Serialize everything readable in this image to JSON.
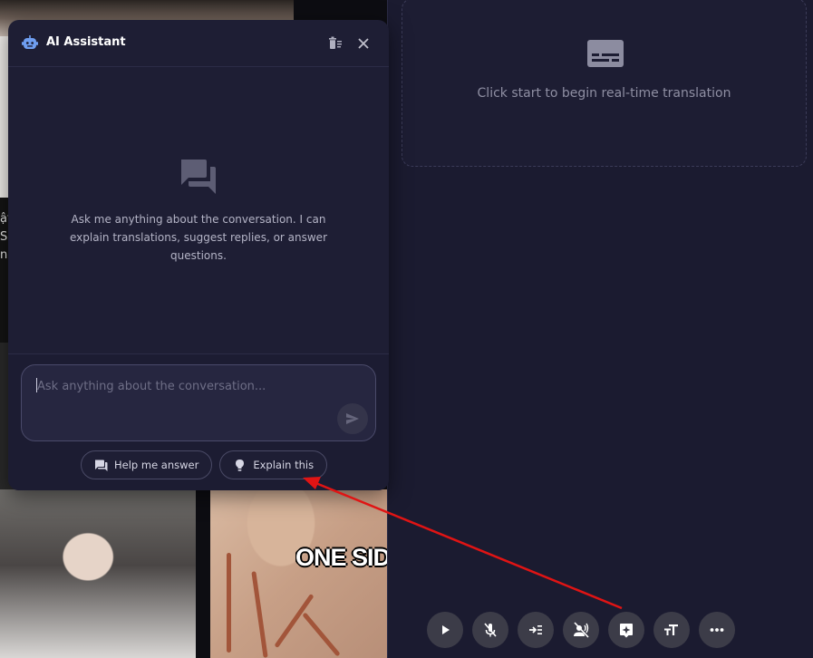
{
  "assistant": {
    "title": "AI Assistant",
    "empty_message": "Ask me anything about the conversation. I can explain translations, suggest replies, or answer questions.",
    "input_placeholder": "Ask anything about the conversation...",
    "input_value": "",
    "chips": [
      {
        "label": "Help me answer",
        "icon": "question-answer-icon"
      },
      {
        "label": "Explain this",
        "icon": "lightbulb-icon"
      }
    ]
  },
  "translation": {
    "hint": "Click start to begin real-time translation"
  },
  "toolbar": {
    "buttons": [
      {
        "name": "play-button",
        "icon": "play-icon"
      },
      {
        "name": "mute-mic-button",
        "icon": "mic-off-icon"
      },
      {
        "name": "input-button",
        "icon": "input-icon"
      },
      {
        "name": "voice-off-button",
        "icon": "voice-off-icon"
      },
      {
        "name": "ai-assistant-button",
        "icon": "assistant-icon"
      },
      {
        "name": "text-size-button",
        "icon": "text-size-icon"
      },
      {
        "name": "more-button",
        "icon": "more-horiz-icon"
      }
    ]
  },
  "background": {
    "overlay_caption": "ONE SID",
    "side_letters": "ật\nSic\nne"
  },
  "colors": {
    "accent_blue": "#6f9ef0",
    "panel_bg": "#1e1e34",
    "annotation_red": "#e01414"
  }
}
